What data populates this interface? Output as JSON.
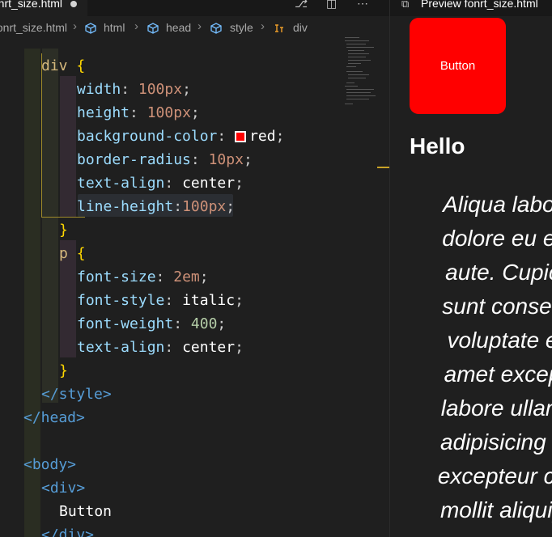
{
  "editor": {
    "tab": {
      "label": "fonrt_size.html"
    },
    "breadcrumb": [
      "fonrt_size.html",
      "html",
      "head",
      "style",
      "div"
    ],
    "code": [
      [
        "div",
        "{"
      ],
      [
        "width",
        "100px"
      ],
      [
        "height",
        "100px"
      ],
      [
        "background-color",
        "red"
      ],
      [
        "border-radius",
        "10px"
      ],
      [
        "text-align",
        "center"
      ],
      [
        "line-height",
        "100px"
      ],
      [
        "}"
      ],
      [
        "p",
        "{"
      ],
      [
        "font-size",
        "2em"
      ],
      [
        "font-style",
        "italic"
      ],
      [
        "font-weight",
        "400"
      ],
      [
        "text-align",
        "center"
      ],
      [
        "}"
      ],
      [
        "</style>"
      ],
      [
        "</head>"
      ],
      [
        ""
      ],
      [
        "<body>"
      ],
      [
        "<div>"
      ],
      [
        "Button"
      ],
      [
        "</div>"
      ]
    ]
  },
  "preview": {
    "tab": {
      "label": "Preview fonrt_size.html"
    },
    "button_text": "Button",
    "heading": "Hello",
    "paragraph_lines": [
      "Aliqua labor",
      "dolore eu er",
      "aute. Cupic",
      "sunt consec",
      "voluptate e",
      "amet excep",
      "labore ullam",
      "adipisicing e",
      "excepteur co",
      "mollit aliquip"
    ]
  },
  "colors": {
    "swatch_red": "#ff0000",
    "button_bg": "#ff0000"
  }
}
